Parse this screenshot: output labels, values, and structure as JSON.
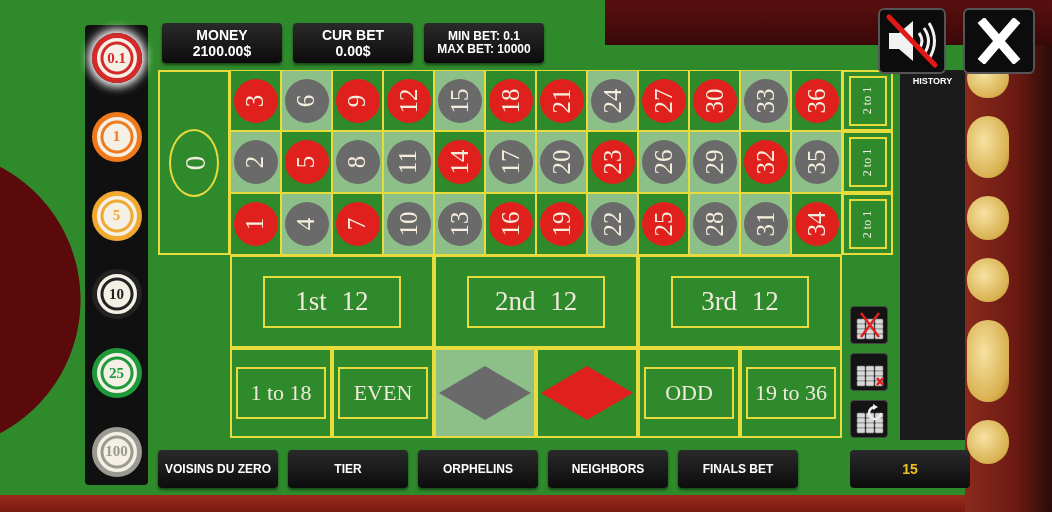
{
  "top_buttons": {
    "muted": true
  },
  "chips": [
    {
      "label": "0.1",
      "color": "#d42a2a",
      "selected": true
    },
    {
      "label": "1",
      "color": "#f07a1a",
      "selected": false
    },
    {
      "label": "5",
      "color": "#f0a830",
      "selected": false
    },
    {
      "label": "10",
      "color": "#222222",
      "selected": false
    },
    {
      "label": "25",
      "color": "#1e9a3a",
      "selected": false
    },
    {
      "label": "100",
      "color": "#9a9a90",
      "selected": false
    }
  ],
  "info": [
    {
      "lines": [
        "MONEY",
        "2100.00$"
      ]
    },
    {
      "lines": [
        "CUR BET",
        "0.00$"
      ]
    },
    {
      "lines": [
        "MIN BET: 0.1",
        "MAX BET: 10000"
      ]
    }
  ],
  "zero": "0",
  "numbers": [
    [
      {
        "n": "3",
        "color": "#e0201c",
        "highlighted": false
      },
      {
        "n": "6",
        "color": "#6a6a6a",
        "highlighted": true
      },
      {
        "n": "9",
        "color": "#e0201c",
        "highlighted": false
      },
      {
        "n": "12",
        "color": "#e0201c",
        "highlighted": false
      },
      {
        "n": "15",
        "color": "#6a6a6a",
        "highlighted": true
      },
      {
        "n": "18",
        "color": "#e0201c",
        "highlighted": false
      },
      {
        "n": "21",
        "color": "#e0201c",
        "highlighted": false
      },
      {
        "n": "24",
        "color": "#6a6a6a",
        "highlighted": true
      },
      {
        "n": "27",
        "color": "#e0201c",
        "highlighted": false
      },
      {
        "n": "30",
        "color": "#e0201c",
        "highlighted": false
      },
      {
        "n": "33",
        "color": "#6a6a6a",
        "highlighted": true
      },
      {
        "n": "36",
        "color": "#e0201c",
        "highlighted": false
      }
    ],
    [
      {
        "n": "2",
        "color": "#6a6a6a",
        "highlighted": true
      },
      {
        "n": "5",
        "color": "#e0201c",
        "highlighted": false
      },
      {
        "n": "8",
        "color": "#6a6a6a",
        "highlighted": true
      },
      {
        "n": "11",
        "color": "#6a6a6a",
        "highlighted": true
      },
      {
        "n": "14",
        "color": "#e0201c",
        "highlighted": false
      },
      {
        "n": "17",
        "color": "#6a6a6a",
        "highlighted": true
      },
      {
        "n": "20",
        "color": "#6a6a6a",
        "highlighted": true
      },
      {
        "n": "23",
        "color": "#e0201c",
        "highlighted": false
      },
      {
        "n": "26",
        "color": "#6a6a6a",
        "highlighted": true
      },
      {
        "n": "29",
        "color": "#6a6a6a",
        "highlighted": true
      },
      {
        "n": "32",
        "color": "#e0201c",
        "highlighted": false
      },
      {
        "n": "35",
        "color": "#6a6a6a",
        "highlighted": true
      }
    ],
    [
      {
        "n": "1",
        "color": "#e0201c",
        "highlighted": false
      },
      {
        "n": "4",
        "color": "#6a6a6a",
        "highlighted": true
      },
      {
        "n": "7",
        "color": "#e0201c",
        "highlighted": false
      },
      {
        "n": "10",
        "color": "#6a6a6a",
        "highlighted": true
      },
      {
        "n": "13",
        "color": "#6a6a6a",
        "highlighted": true
      },
      {
        "n": "16",
        "color": "#e0201c",
        "highlighted": false
      },
      {
        "n": "19",
        "color": "#e0201c",
        "highlighted": false
      },
      {
        "n": "22",
        "color": "#6a6a6a",
        "highlighted": true
      },
      {
        "n": "25",
        "color": "#e0201c",
        "highlighted": false
      },
      {
        "n": "28",
        "color": "#6a6a6a",
        "highlighted": true
      },
      {
        "n": "31",
        "color": "#6a6a6a",
        "highlighted": true
      },
      {
        "n": "34",
        "color": "#e0201c",
        "highlighted": false
      }
    ]
  ],
  "columns": [
    "2 to 1",
    "2 to 1",
    "2 to 1"
  ],
  "dozens": [
    "1st 12",
    "2nd 12",
    "3rd 12"
  ],
  "outside": [
    {
      "kind": "text",
      "label": "1 to 18",
      "highlighted": false
    },
    {
      "kind": "text",
      "label": "EVEN",
      "highlighted": false
    },
    {
      "kind": "diamond",
      "color": "#6a6a6a",
      "highlighted": true
    },
    {
      "kind": "diamond",
      "color": "#e0201c",
      "highlighted": false
    },
    {
      "kind": "text",
      "label": "ODD",
      "highlighted": false
    },
    {
      "kind": "text",
      "label": "19 to 36",
      "highlighted": false
    }
  ],
  "bet_tools": [
    {
      "kind": "clear"
    },
    {
      "kind": "undo"
    },
    {
      "kind": "rebet"
    }
  ],
  "history": {
    "title": "HISTORY"
  },
  "bet_buttons": [
    "VOISINS DU ZERO",
    "TIER",
    "ORPHELINS",
    "NEIGHBORS",
    "FINALS BET"
  ],
  "counter": "15"
}
